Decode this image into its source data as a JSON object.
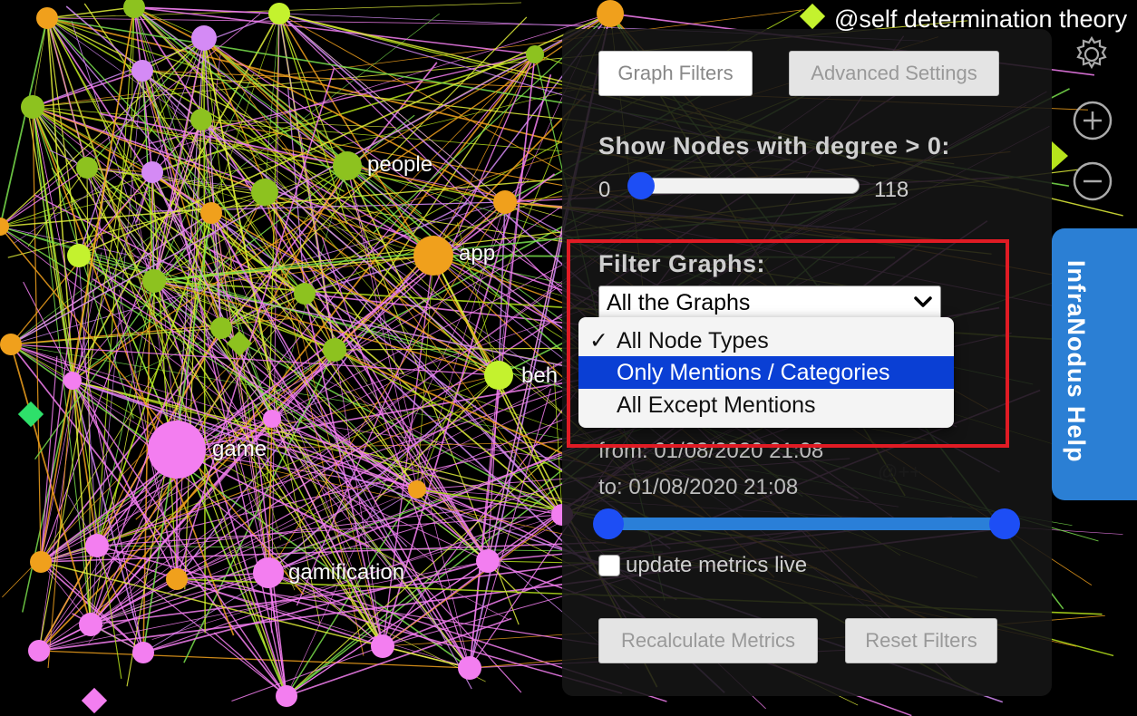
{
  "graph": {
    "top_label": "@self determination theory",
    "node_labels": [
      {
        "text": "people",
        "side": "left"
      },
      {
        "text": "app",
        "side": "left"
      },
      {
        "text": "beh",
        "side": "left"
      },
      {
        "text": "game",
        "side": "left"
      },
      {
        "text": "gamification",
        "side": "left"
      }
    ],
    "faint_label": "@++",
    "colors": {
      "green": "#8dc21f",
      "lime": "#c4f22e",
      "orange": "#f0a01c",
      "pink": "#f37ef0",
      "violet": "#d48af5",
      "teal": "#2ee06a"
    }
  },
  "controls": {
    "settings_icon": "gear-icon",
    "zoom_in_icon": "plus-circle-icon",
    "zoom_out_icon": "minus-circle-icon",
    "collapse_icon": "triangle-right-icon"
  },
  "panel": {
    "tabs": {
      "graph_filters": "Graph Filters",
      "advanced_settings": "Advanced Settings"
    },
    "degree": {
      "title": "Show Nodes with degree > 0:",
      "min": "0",
      "max": "118"
    },
    "filter_graphs": {
      "title": "Filter Graphs:",
      "selected": "All the Graphs"
    },
    "time": {
      "from": "from: 01/08/2020 21:08",
      "to": "to: 01/08/2020 21:08"
    },
    "update_metrics_label": "update metrics live",
    "buttons": {
      "recalculate": "Recalculate Metrics",
      "reset": "Reset Filters"
    }
  },
  "dropdown": {
    "items": [
      {
        "label": "All Node Types",
        "checked": "✓"
      },
      {
        "label": "Only Mentions / Categories",
        "checked": ""
      },
      {
        "label": "All Except Mentions",
        "checked": ""
      }
    ],
    "highlighted_index": 1,
    "highlight_color": "#0a3fd4"
  },
  "help_tab": {
    "label": "InfraNodus Help",
    "color": "#2b7fd4"
  },
  "annotation": {
    "box_color": "#e01b24"
  }
}
